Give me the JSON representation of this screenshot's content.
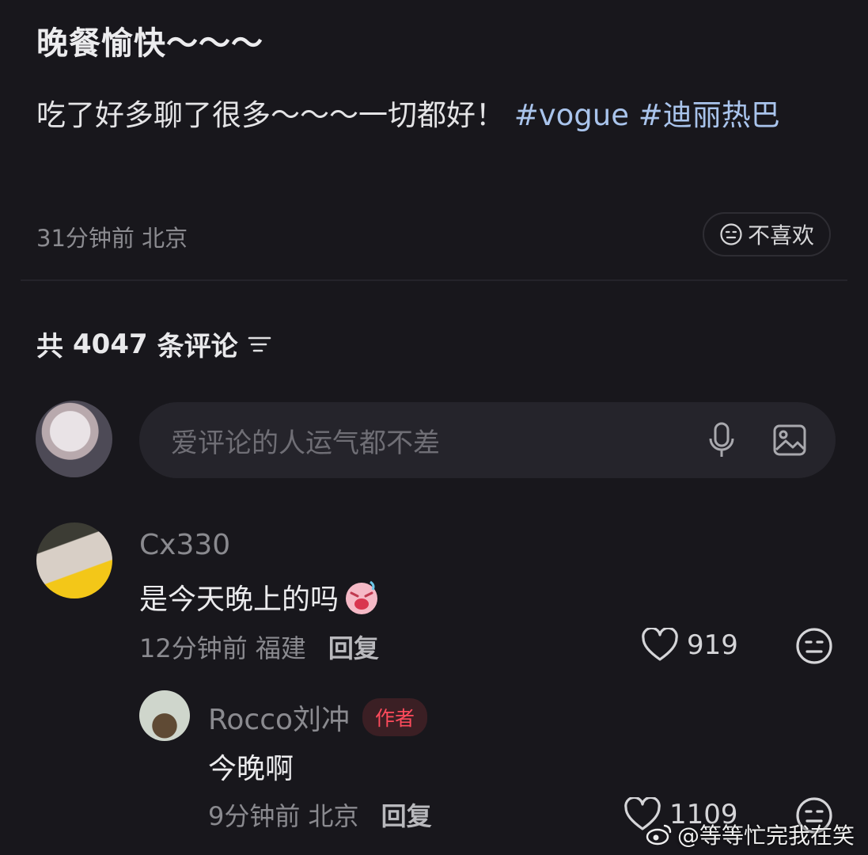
{
  "post": {
    "title": "晚餐愉快～～～",
    "text": "吃了好多聊了很多～～～一切都好！",
    "tags": [
      "#vogue",
      "#迪丽热巴"
    ],
    "meta": "31分钟前 北京",
    "dislike_label": "不喜欢"
  },
  "comments_header": {
    "prefix": "共",
    "count": "4047",
    "suffix": "条评论"
  },
  "comment_input": {
    "placeholder": "爱评论的人运气都不差"
  },
  "comment": {
    "username": "Cx330",
    "text": "是今天晚上的吗",
    "time": "12分钟前",
    "location": "福建",
    "reply_label": "回复",
    "likes": "919"
  },
  "reply": {
    "username": "Rocco刘冲",
    "badge": "作者",
    "text": "今晚啊",
    "time": "9分钟前",
    "location": "北京",
    "reply_label": "回复",
    "likes": "1109"
  },
  "watermark": {
    "text": "@等等忙完我在笑"
  },
  "colors": {
    "background": "#18171c",
    "tag": "#a9c4ec",
    "author_badge": "#ff4b5c"
  }
}
